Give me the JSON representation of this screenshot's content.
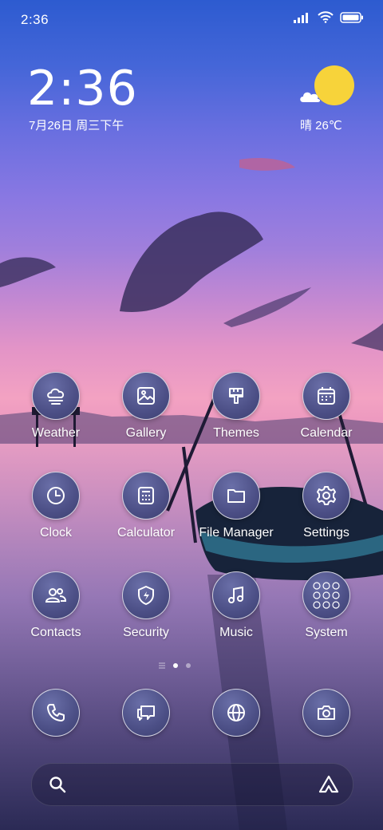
{
  "status_bar": {
    "time": "2:36"
  },
  "clock_widget": {
    "time": "2:36",
    "date": "7月26日 周三下午"
  },
  "weather_widget": {
    "text": "晴 26℃"
  },
  "apps": [
    {
      "label": "Weather",
      "icon": "weather-cloud-icon"
    },
    {
      "label": "Gallery",
      "icon": "gallery-icon"
    },
    {
      "label": "Themes",
      "icon": "themes-brush-icon"
    },
    {
      "label": "Calendar",
      "icon": "calendar-icon"
    },
    {
      "label": "Clock",
      "icon": "clock-icon"
    },
    {
      "label": "Calculator",
      "icon": "calculator-icon"
    },
    {
      "label": "File Manager",
      "icon": "folder-icon"
    },
    {
      "label": "Settings",
      "icon": "gear-icon"
    },
    {
      "label": "Contacts",
      "icon": "contacts-icon"
    },
    {
      "label": "Security",
      "icon": "shield-icon"
    },
    {
      "label": "Music",
      "icon": "music-note-icon"
    },
    {
      "label": "System",
      "icon": "folder-grid-icon"
    }
  ],
  "dock": [
    {
      "icon": "phone-icon"
    },
    {
      "icon": "messages-icon"
    },
    {
      "icon": "browser-globe-icon"
    },
    {
      "icon": "camera-icon"
    }
  ],
  "page_indicator": {
    "pages": 2,
    "current": 1
  },
  "colors": {
    "sun": "#f7d33a",
    "icon_bg": "#4c4f86"
  }
}
